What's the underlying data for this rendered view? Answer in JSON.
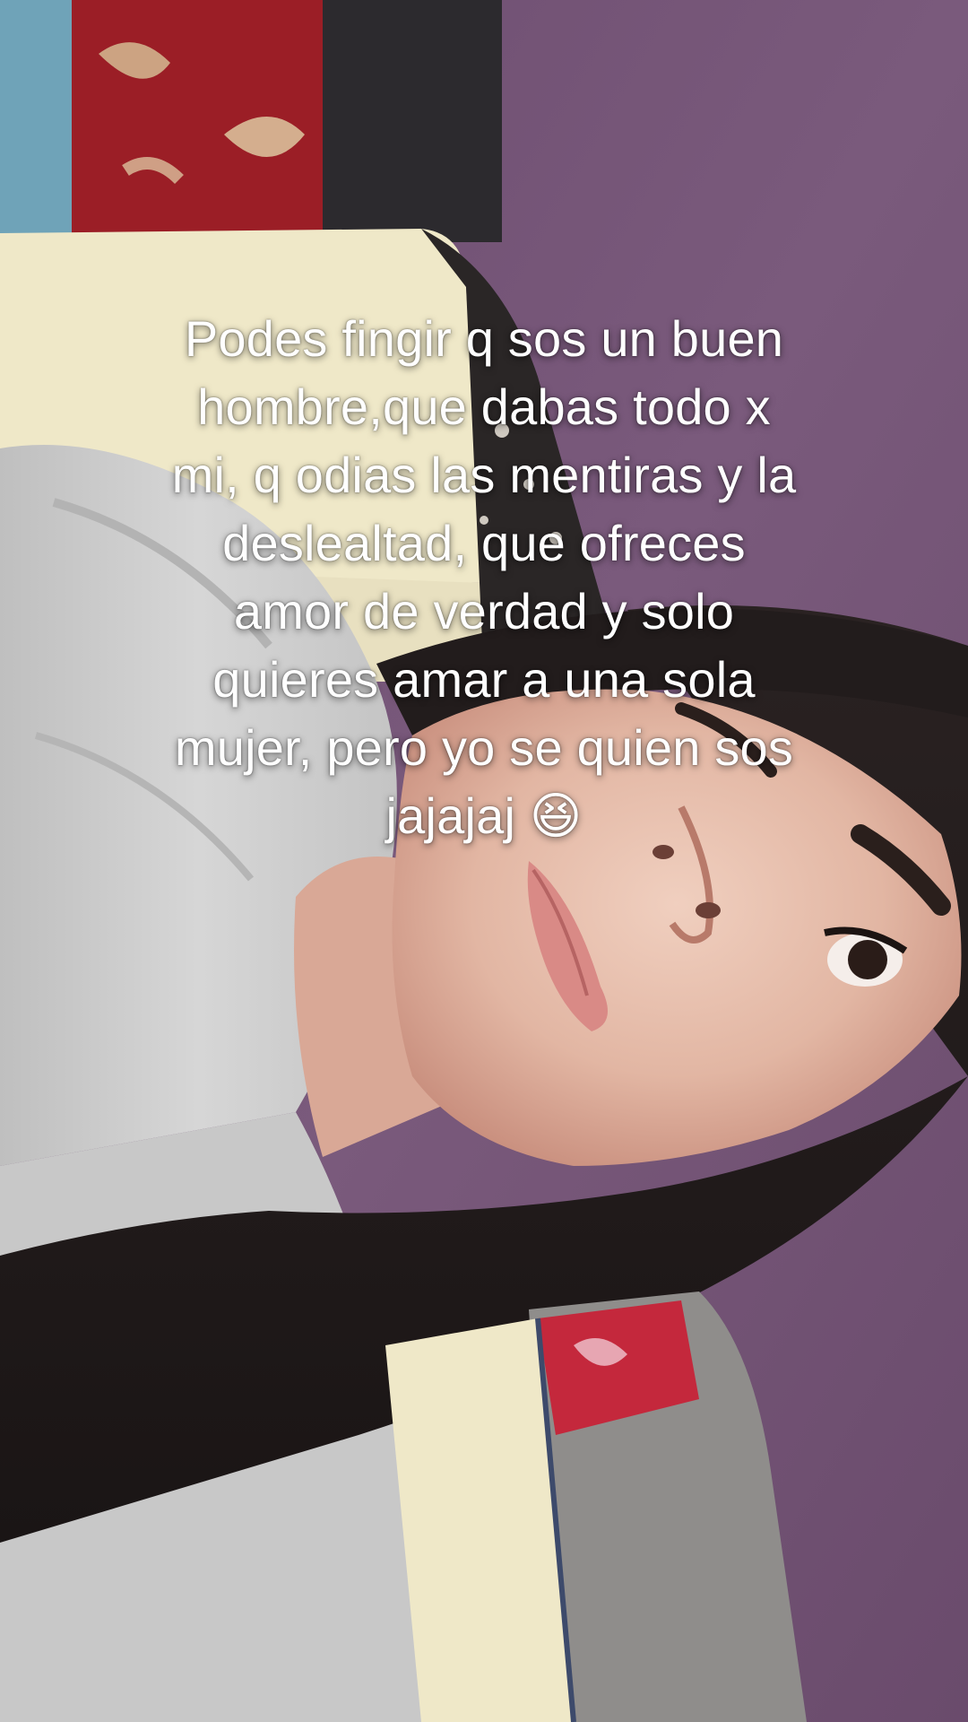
{
  "caption": {
    "lines": [
      "Podes fingir q sos un buen",
      "hombre,que dabas todo x",
      "mi, q odias las mentiras y la",
      "deslealtad, que ofreces",
      "amor de verdad y solo",
      "quieres amar a una sola",
      "mujer, pero yo se quien sos",
      "jajajaj 😆"
    ]
  },
  "colors": {
    "wall": "#6f4f72",
    "caption_text": "#ffffff"
  }
}
